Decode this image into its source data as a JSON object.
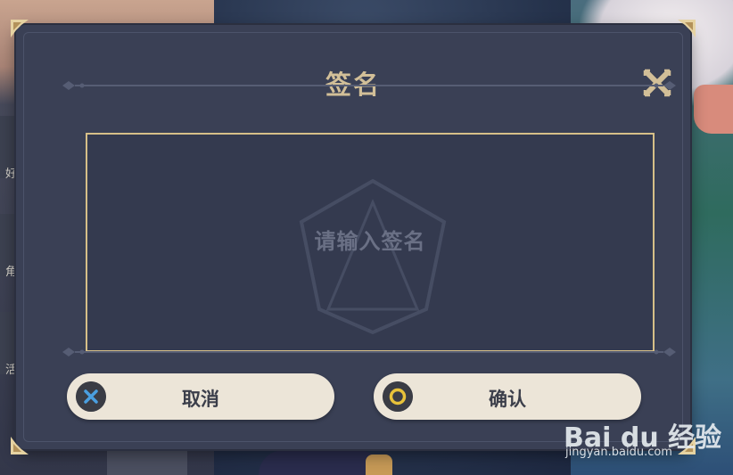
{
  "dialog": {
    "title": "签名",
    "close_icon": "close-x-icon",
    "signature_placeholder": "请输入签名"
  },
  "buttons": {
    "cancel": {
      "label": "取消",
      "icon": "cross-button-icon"
    },
    "confirm": {
      "label": "确认",
      "icon": "circle-button-icon"
    }
  },
  "sidebar": {
    "labels": [
      "好",
      "角",
      "活"
    ]
  },
  "watermark": {
    "logo_text": "Bai du 经验",
    "url": "jingyan.baidu.com"
  },
  "colors": {
    "title_gold": "#d2bf98",
    "frame_gold": "#d6bf88",
    "panel": "#3a4055",
    "button_bg": "#ece5d8",
    "cancel_accent": "#4a9fe0",
    "confirm_accent": "#e8c23a"
  }
}
